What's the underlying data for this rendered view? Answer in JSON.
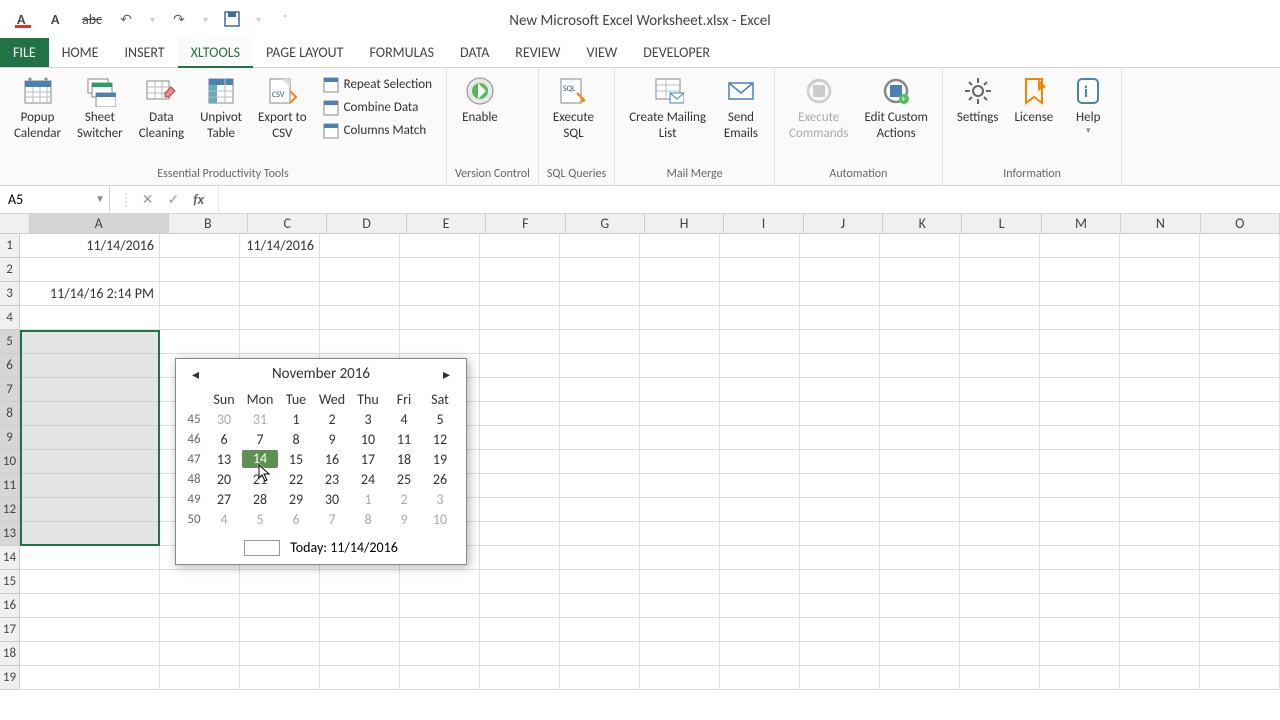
{
  "window_title": "New Microsoft Excel Worksheet.xlsx - Excel",
  "qat_icons": [
    "font-color",
    "font",
    "strikethrough",
    "undo",
    "redo",
    "save",
    "customize"
  ],
  "tabs": [
    "FILE",
    "HOME",
    "INSERT",
    "XLTools",
    "PAGE LAYOUT",
    "FORMULAS",
    "DATA",
    "REVIEW",
    "VIEW",
    "DEVELOPER"
  ],
  "active_tab": "XLTools",
  "ribbon_groups": [
    {
      "label": "Essential Productivity Tools",
      "big": [
        "Popup Calendar",
        "Sheet Switcher",
        "Data Cleaning",
        "Unpivot Table",
        "Export to CSV"
      ],
      "small": [
        "Repeat Selection",
        "Combine Data",
        "Columns Match"
      ]
    },
    {
      "label": "Version Control",
      "big": [
        "Enable"
      ]
    },
    {
      "label": "SQL Queries",
      "big": [
        "Execute SQL"
      ]
    },
    {
      "label": "Mail Merge",
      "big": [
        "Create Mailing List",
        "Send Emails"
      ]
    },
    {
      "label": "Automation",
      "big": [
        "Execute Commands",
        "Edit Custom Actions"
      ]
    },
    {
      "label": "Information",
      "big": [
        "Settings",
        "License",
        "Help"
      ]
    }
  ],
  "name_box": "A5",
  "formula": "",
  "columns": [
    "A",
    "B",
    "C",
    "D",
    "E",
    "F",
    "G",
    "H",
    "I",
    "J",
    "K",
    "L",
    "M",
    "N",
    "O"
  ],
  "rows": [
    1,
    2,
    3,
    4,
    5,
    6,
    7,
    8,
    9,
    10,
    11,
    12,
    13,
    14,
    15,
    16,
    17,
    18,
    19
  ],
  "cells_data": {
    "A1": "11/14/2016",
    "C1": "11/14/2016",
    "A3": "11/14/16 2:14 PM"
  },
  "selection": {
    "start": "A5",
    "end": "A13"
  },
  "calendar": {
    "month_label": "November 2016",
    "dow": [
      "Sun",
      "Mon",
      "Tue",
      "Wed",
      "Thu",
      "Fri",
      "Sat"
    ],
    "weeks": [
      {
        "wk": 45,
        "days": [
          {
            "d": "30",
            "o": true
          },
          {
            "d": "31",
            "o": true
          },
          {
            "d": "1"
          },
          {
            "d": "2"
          },
          {
            "d": "3"
          },
          {
            "d": "4"
          },
          {
            "d": "5"
          }
        ]
      },
      {
        "wk": 46,
        "days": [
          {
            "d": "6"
          },
          {
            "d": "7"
          },
          {
            "d": "8"
          },
          {
            "d": "9"
          },
          {
            "d": "10"
          },
          {
            "d": "11"
          },
          {
            "d": "12"
          }
        ]
      },
      {
        "wk": 47,
        "days": [
          {
            "d": "13"
          },
          {
            "d": "14",
            "today": true
          },
          {
            "d": "15"
          },
          {
            "d": "16"
          },
          {
            "d": "17"
          },
          {
            "d": "18"
          },
          {
            "d": "19"
          }
        ]
      },
      {
        "wk": 48,
        "days": [
          {
            "d": "20"
          },
          {
            "d": "21"
          },
          {
            "d": "22"
          },
          {
            "d": "23"
          },
          {
            "d": "24"
          },
          {
            "d": "25"
          },
          {
            "d": "26"
          }
        ]
      },
      {
        "wk": 49,
        "days": [
          {
            "d": "27"
          },
          {
            "d": "28"
          },
          {
            "d": "29"
          },
          {
            "d": "30"
          },
          {
            "d": "1",
            "o": true
          },
          {
            "d": "2",
            "o": true
          },
          {
            "d": "3",
            "o": true
          }
        ]
      },
      {
        "wk": 50,
        "days": [
          {
            "d": "4",
            "o": true
          },
          {
            "d": "5",
            "o": true
          },
          {
            "d": "6",
            "o": true
          },
          {
            "d": "7",
            "o": true
          },
          {
            "d": "8",
            "o": true
          },
          {
            "d": "9",
            "o": true
          },
          {
            "d": "10",
            "o": true
          }
        ]
      }
    ],
    "today_label": "Today: 11/14/2016"
  }
}
